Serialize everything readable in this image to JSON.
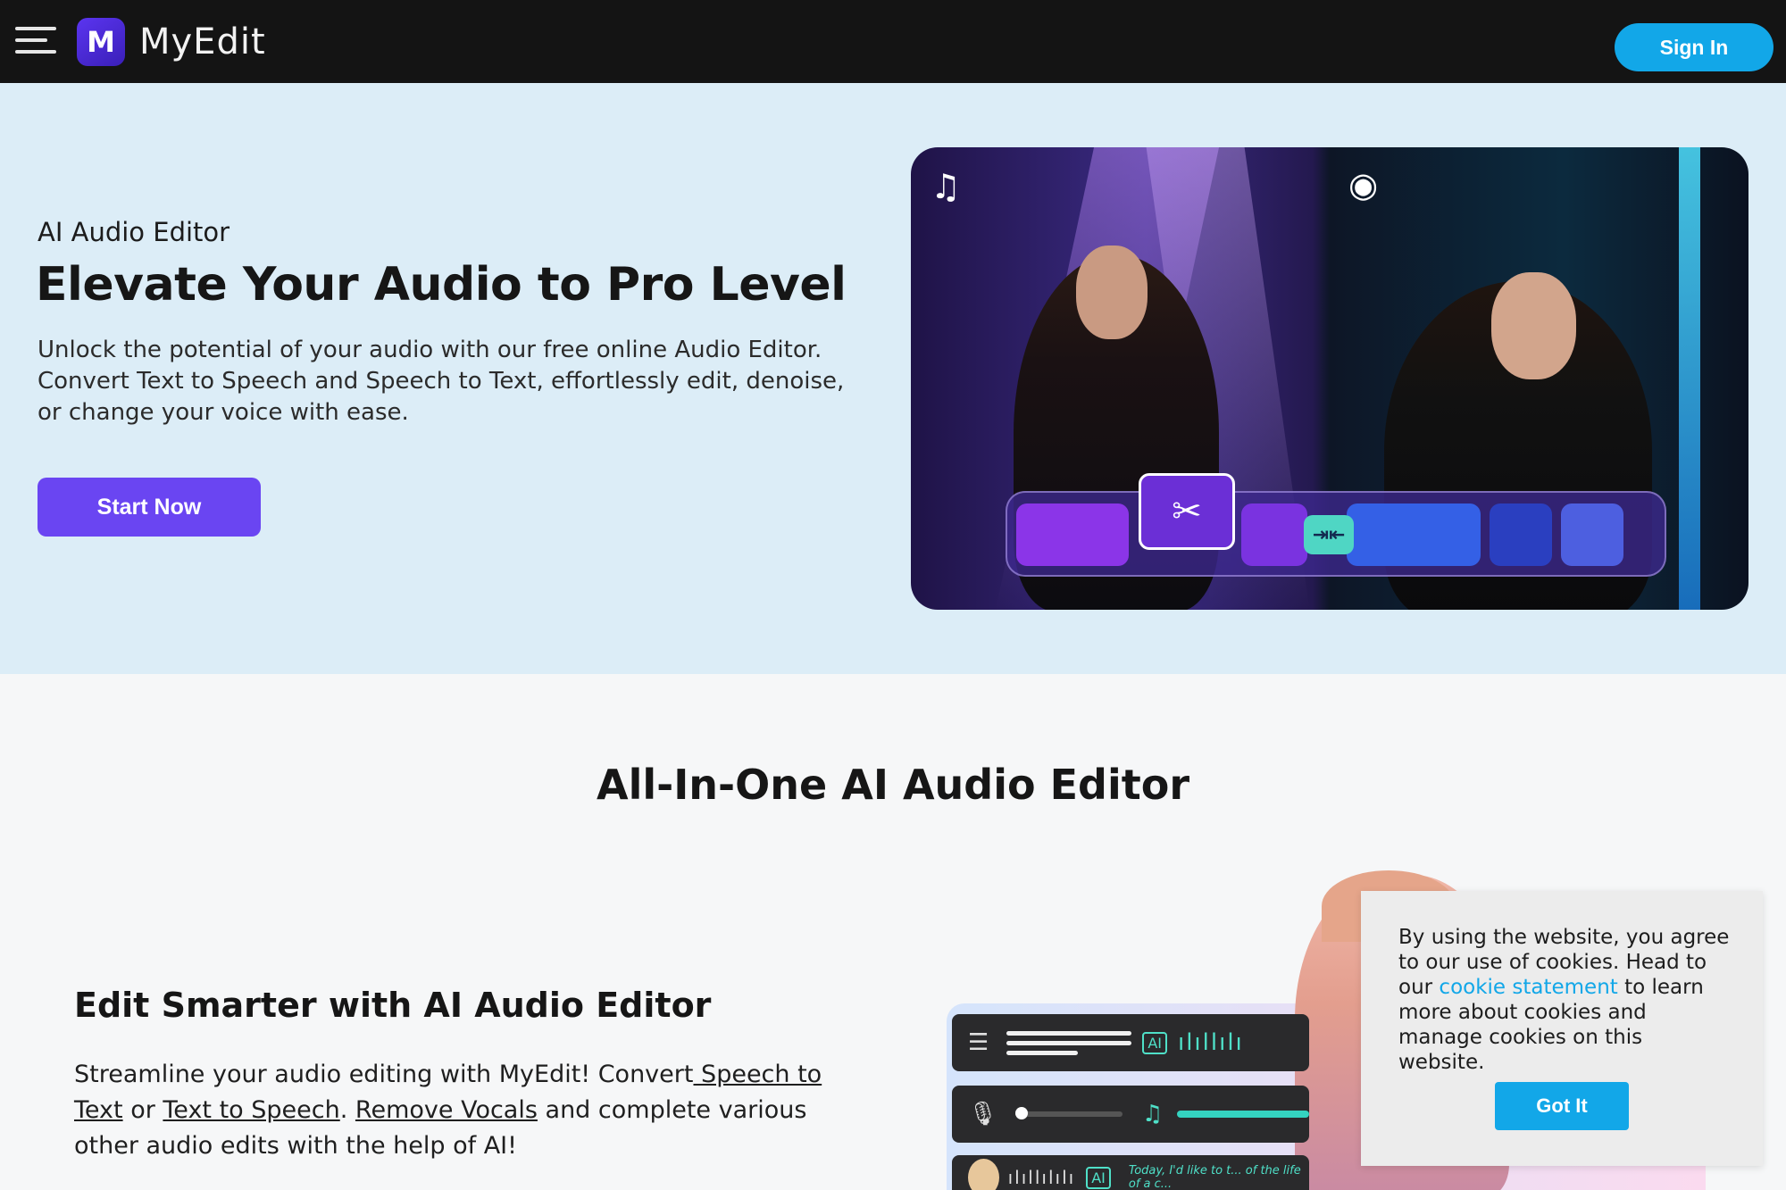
{
  "header": {
    "logo_mark": "M",
    "logo_text": "MyEdit",
    "sign_in_label": "Sign In"
  },
  "hero": {
    "eyebrow": "AI Audio Editor",
    "title": "Elevate Your Audio to Pro Level",
    "description": "Unlock the potential of your audio with our free online Audio Editor. Convert Text to Speech and Speech to Text, effortlessly edit, denoise, or change your voice with ease.",
    "cta_label": "Start Now"
  },
  "features": {
    "section_title": "All-In-One AI Audio Editor",
    "subsection_title": "Edit Smarter with AI Audio Editor",
    "desc_part1": "Streamline your audio editing with MyEdit! Convert",
    "link_speech_to_text": " Speech to Text",
    "desc_part2": " or ",
    "link_text_to_speech": "Text to Speech",
    "desc_part3": ". ",
    "link_remove_vocals": "Remove Vocals",
    "desc_part4": " and complete various other audio edits with the help of AI!"
  },
  "illustration": {
    "ai_chip": "AI",
    "row3_text": "Today, I'd like to t... of the life of a c..."
  },
  "cookie": {
    "text_before": "By using the website, you agree to our use of cookies. Head to our ",
    "link_label": "cookie statement",
    "text_after": " to learn more about cookies and manage cookies on this website.",
    "button_label": "Got It"
  },
  "colors": {
    "header_bg": "#141414",
    "brand_purple": "#6a45f2",
    "accent_blue": "#12a7e8",
    "hero_bg": "#dcedf7"
  },
  "icons": [
    "menu-icon",
    "music-ai-icon",
    "podcast-icon",
    "scissors-icon",
    "merge-icon",
    "document-icon",
    "mic-icon",
    "music-note-icon"
  ]
}
